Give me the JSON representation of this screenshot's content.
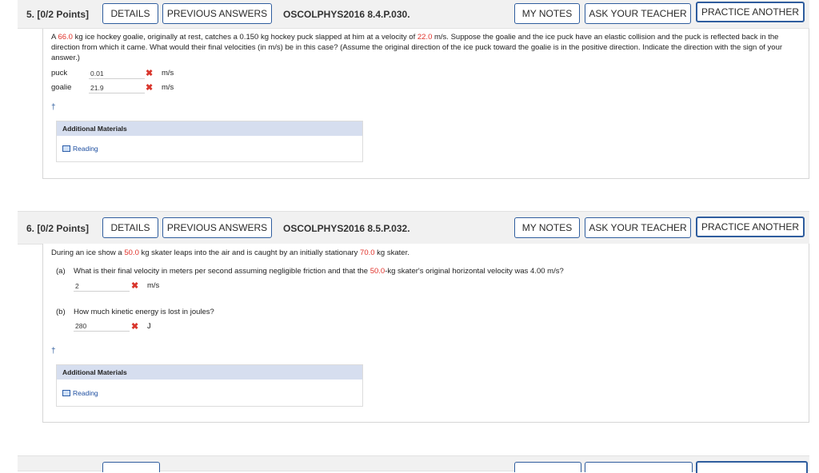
{
  "buttons": {
    "details": "DETAILS",
    "previous_answers": "PREVIOUS ANSWERS",
    "my_notes": "MY NOTES",
    "ask_teacher": "ASK YOUR TEACHER",
    "practice_another": "PRACTICE ANOTHER"
  },
  "q5": {
    "number": "5.  [0/2 Points]",
    "id": "OSCOLPHYS2016 8.4.P.030.",
    "text_a": "A ",
    "mass_goalie": "66.0",
    "text_b": " kg ice hockey goalie, originally at rest, catches a 0.150 kg hockey puck slapped at him at a velocity of ",
    "velocity": "22.0",
    "text_c": " m/s. Suppose the goalie and the ice puck have an elastic collision and the puck is reflected back in the direction from which it came. What would their final velocities (in m/s) be in this case? (Assume the original direction of the ice puck toward the goalie is in the positive direction. Indicate the direction with the sign of your answer.)",
    "answers": [
      {
        "label": "puck",
        "value": "0.01",
        "unit": "m/s"
      },
      {
        "label": "goalie",
        "value": "21.9",
        "unit": "m/s"
      }
    ],
    "dagger": "†",
    "additional_materials": "Additional Materials",
    "reading": "Reading"
  },
  "q6": {
    "number": "6.  [0/2 Points]",
    "id": "OSCOLPHYS2016 8.5.P.032.",
    "intro_a": "During an ice show a ",
    "mass1": "50.0",
    "intro_b": " kg skater leaps into the air and is caught by an initially stationary ",
    "mass2": "70.0",
    "intro_c": " kg skater.",
    "part_a_label": "(a)",
    "part_a_text_a": "What is their final velocity in meters per second assuming negligible friction and that the ",
    "part_a_mass": "50.0",
    "part_a_text_b": "-kg skater's original horizontal velocity was 4.00 m/s?",
    "part_a_value": "2",
    "part_a_unit": "m/s",
    "part_b_label": "(b)",
    "part_b_text": "How much kinetic energy is lost in joules?",
    "part_b_value": "280",
    "part_b_unit": "J",
    "dagger": "†",
    "additional_materials": "Additional Materials",
    "reading": "Reading"
  },
  "icons": {
    "wrong": "✖"
  }
}
